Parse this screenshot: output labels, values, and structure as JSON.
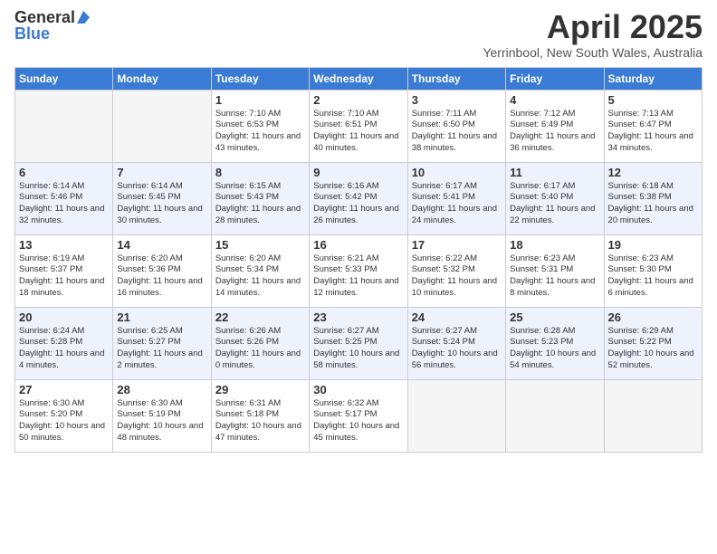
{
  "header": {
    "logo_general": "General",
    "logo_blue": "Blue",
    "month_title": "April 2025",
    "location": "Yerrinbool, New South Wales, Australia"
  },
  "days_of_week": [
    "Sunday",
    "Monday",
    "Tuesday",
    "Wednesday",
    "Thursday",
    "Friday",
    "Saturday"
  ],
  "weeks": [
    [
      {
        "day": "",
        "info": "",
        "empty": true
      },
      {
        "day": "",
        "info": "",
        "empty": true
      },
      {
        "day": "1",
        "info": "Sunrise: 7:10 AM\nSunset: 6:53 PM\nDaylight: 11 hours and 43 minutes.",
        "empty": false
      },
      {
        "day": "2",
        "info": "Sunrise: 7:10 AM\nSunset: 6:51 PM\nDaylight: 11 hours and 40 minutes.",
        "empty": false
      },
      {
        "day": "3",
        "info": "Sunrise: 7:11 AM\nSunset: 6:50 PM\nDaylight: 11 hours and 38 minutes.",
        "empty": false
      },
      {
        "day": "4",
        "info": "Sunrise: 7:12 AM\nSunset: 6:49 PM\nDaylight: 11 hours and 36 minutes.",
        "empty": false
      },
      {
        "day": "5",
        "info": "Sunrise: 7:13 AM\nSunset: 6:47 PM\nDaylight: 11 hours and 34 minutes.",
        "empty": false
      }
    ],
    [
      {
        "day": "6",
        "info": "Sunrise: 6:14 AM\nSunset: 5:46 PM\nDaylight: 11 hours and 32 minutes.",
        "empty": false
      },
      {
        "day": "7",
        "info": "Sunrise: 6:14 AM\nSunset: 5:45 PM\nDaylight: 11 hours and 30 minutes.",
        "empty": false
      },
      {
        "day": "8",
        "info": "Sunrise: 6:15 AM\nSunset: 5:43 PM\nDaylight: 11 hours and 28 minutes.",
        "empty": false
      },
      {
        "day": "9",
        "info": "Sunrise: 6:16 AM\nSunset: 5:42 PM\nDaylight: 11 hours and 26 minutes.",
        "empty": false
      },
      {
        "day": "10",
        "info": "Sunrise: 6:17 AM\nSunset: 5:41 PM\nDaylight: 11 hours and 24 minutes.",
        "empty": false
      },
      {
        "day": "11",
        "info": "Sunrise: 6:17 AM\nSunset: 5:40 PM\nDaylight: 11 hours and 22 minutes.",
        "empty": false
      },
      {
        "day": "12",
        "info": "Sunrise: 6:18 AM\nSunset: 5:38 PM\nDaylight: 11 hours and 20 minutes.",
        "empty": false
      }
    ],
    [
      {
        "day": "13",
        "info": "Sunrise: 6:19 AM\nSunset: 5:37 PM\nDaylight: 11 hours and 18 minutes.",
        "empty": false
      },
      {
        "day": "14",
        "info": "Sunrise: 6:20 AM\nSunset: 5:36 PM\nDaylight: 11 hours and 16 minutes.",
        "empty": false
      },
      {
        "day": "15",
        "info": "Sunrise: 6:20 AM\nSunset: 5:34 PM\nDaylight: 11 hours and 14 minutes.",
        "empty": false
      },
      {
        "day": "16",
        "info": "Sunrise: 6:21 AM\nSunset: 5:33 PM\nDaylight: 11 hours and 12 minutes.",
        "empty": false
      },
      {
        "day": "17",
        "info": "Sunrise: 6:22 AM\nSunset: 5:32 PM\nDaylight: 11 hours and 10 minutes.",
        "empty": false
      },
      {
        "day": "18",
        "info": "Sunrise: 6:23 AM\nSunset: 5:31 PM\nDaylight: 11 hours and 8 minutes.",
        "empty": false
      },
      {
        "day": "19",
        "info": "Sunrise: 6:23 AM\nSunset: 5:30 PM\nDaylight: 11 hours and 6 minutes.",
        "empty": false
      }
    ],
    [
      {
        "day": "20",
        "info": "Sunrise: 6:24 AM\nSunset: 5:28 PM\nDaylight: 11 hours and 4 minutes.",
        "empty": false
      },
      {
        "day": "21",
        "info": "Sunrise: 6:25 AM\nSunset: 5:27 PM\nDaylight: 11 hours and 2 minutes.",
        "empty": false
      },
      {
        "day": "22",
        "info": "Sunrise: 6:26 AM\nSunset: 5:26 PM\nDaylight: 11 hours and 0 minutes.",
        "empty": false
      },
      {
        "day": "23",
        "info": "Sunrise: 6:27 AM\nSunset: 5:25 PM\nDaylight: 10 hours and 58 minutes.",
        "empty": false
      },
      {
        "day": "24",
        "info": "Sunrise: 6:27 AM\nSunset: 5:24 PM\nDaylight: 10 hours and 56 minutes.",
        "empty": false
      },
      {
        "day": "25",
        "info": "Sunrise: 6:28 AM\nSunset: 5:23 PM\nDaylight: 10 hours and 54 minutes.",
        "empty": false
      },
      {
        "day": "26",
        "info": "Sunrise: 6:29 AM\nSunset: 5:22 PM\nDaylight: 10 hours and 52 minutes.",
        "empty": false
      }
    ],
    [
      {
        "day": "27",
        "info": "Sunrise: 6:30 AM\nSunset: 5:20 PM\nDaylight: 10 hours and 50 minutes.",
        "empty": false
      },
      {
        "day": "28",
        "info": "Sunrise: 6:30 AM\nSunset: 5:19 PM\nDaylight: 10 hours and 48 minutes.",
        "empty": false
      },
      {
        "day": "29",
        "info": "Sunrise: 6:31 AM\nSunset: 5:18 PM\nDaylight: 10 hours and 47 minutes.",
        "empty": false
      },
      {
        "day": "30",
        "info": "Sunrise: 6:32 AM\nSunset: 5:17 PM\nDaylight: 10 hours and 45 minutes.",
        "empty": false
      },
      {
        "day": "",
        "info": "",
        "empty": true
      },
      {
        "day": "",
        "info": "",
        "empty": true
      },
      {
        "day": "",
        "info": "",
        "empty": true
      }
    ]
  ]
}
